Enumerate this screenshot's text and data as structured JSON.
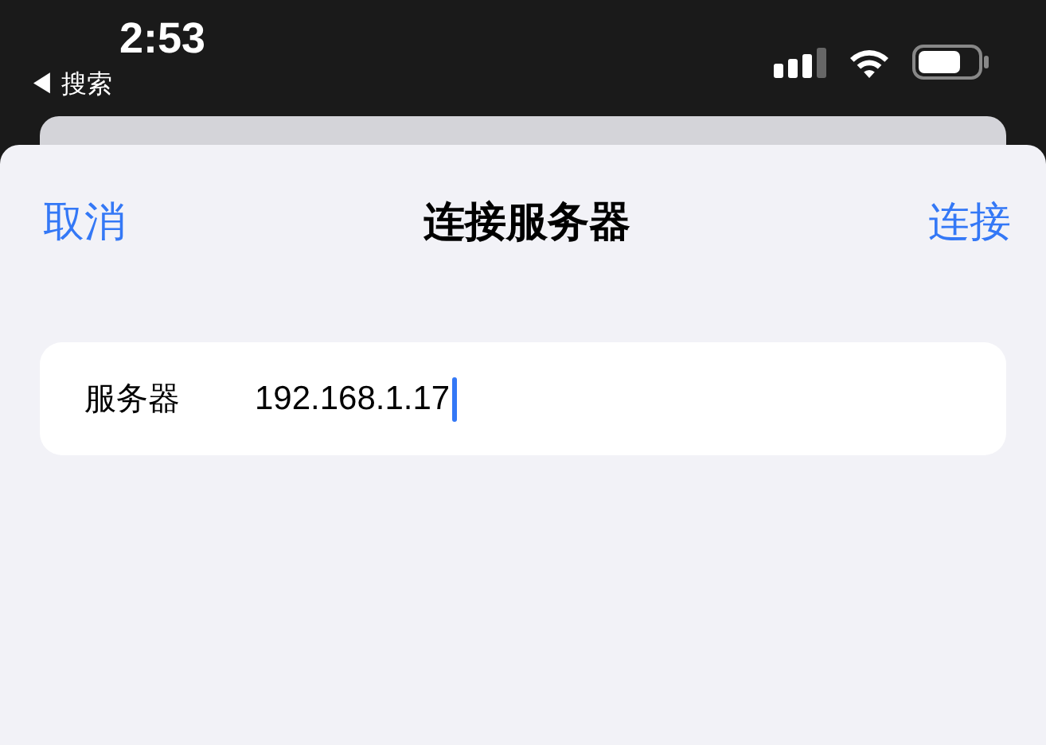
{
  "status_bar": {
    "time": "2:53",
    "back_label": "◀ 搜索"
  },
  "sheet": {
    "cancel": "取消",
    "title": "连接服务器",
    "confirm": "连接"
  },
  "fields": [
    {
      "label": "服务器",
      "value": "192.168.1.17",
      "focused": true
    }
  ]
}
